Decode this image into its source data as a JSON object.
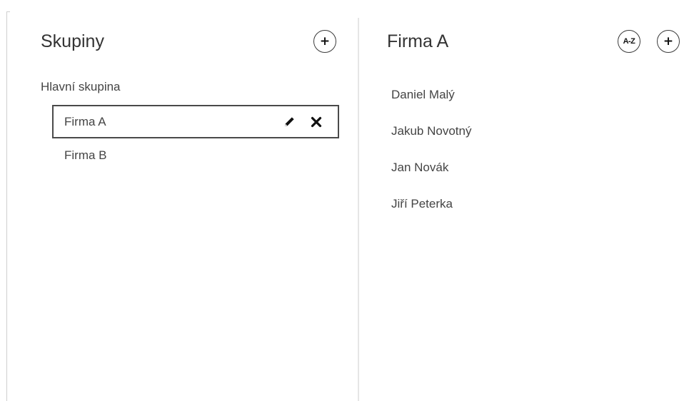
{
  "groups_panel": {
    "title": "Skupiny",
    "add_button_label": "+",
    "root_group": "Hlavní skupina",
    "groups": [
      {
        "label": "Firma A",
        "selected": true
      },
      {
        "label": "Firma B",
        "selected": false
      }
    ],
    "edit_icon": "pencil-icon",
    "delete_icon": "close-icon"
  },
  "members_panel": {
    "title": "Firma A",
    "sort_button_label": "A-Z",
    "add_button_label": "+",
    "members": [
      "Daniel Malý",
      "Jakub Novotný",
      "Jan Novák",
      "Jiří Peterka"
    ]
  }
}
